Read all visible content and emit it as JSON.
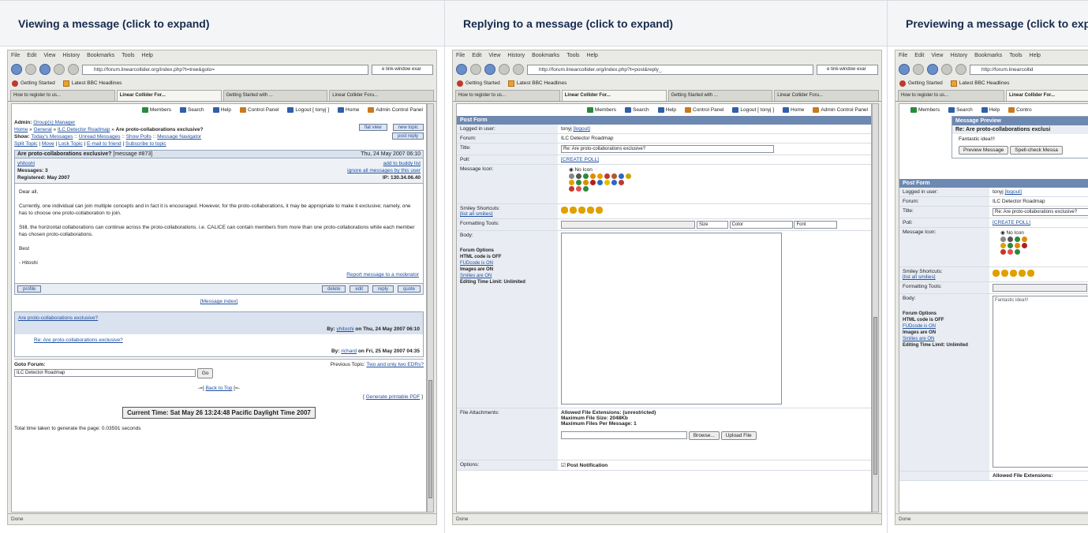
{
  "headers": {
    "view": "Viewing a message (click to expand)",
    "reply": "Replying to a message (click to expand)",
    "preview": "Previewing a message (click to expand)"
  },
  "browser": {
    "menu": [
      "File",
      "Edit",
      "View",
      "History",
      "Bookmarks",
      "Tools",
      "Help"
    ],
    "search_text": "e tink-window exar",
    "bookmarks": [
      "Getting Started",
      "Latest BBC Headlines"
    ],
    "status": "Done"
  },
  "view": {
    "url": "http://forum.linearcollider.org/index.php?t=tree&goto=",
    "tabs": [
      "How to register to us...",
      "Linear Collider For...",
      "Getting Started with ...",
      "Linear Collider Foru..."
    ],
    "toplinks": [
      "Members",
      "Search",
      "Help",
      "Control Panel",
      "Logout [ tonyj ]",
      "Home",
      "Admin Control Panel"
    ],
    "admin_label": "Admin:",
    "admin_link": "Group(s) Manager",
    "breadcrumb": [
      "Home",
      "General",
      "ILC Detector Roadmap"
    ],
    "breadcrumb_title": "Are proto-collaborations exclusive?",
    "show_label": "Show:",
    "show_links": [
      "Today's Messages",
      "Unread Messages",
      "Show Polls",
      "Message Navigator"
    ],
    "actions": [
      "Split Topic",
      "Move",
      "Lock Topic",
      "E-mail to friend",
      "Subscribe to topic"
    ],
    "right_btns": [
      "flat view",
      "new topic",
      "post reply"
    ],
    "msg_title": "Are proto-collaborations exclusive?",
    "msg_num": "[message #873]",
    "msg_date": "Thu, 24 May 2007 06:10",
    "author": "yhitoshi",
    "messages": "Messages: 3",
    "registered": "Registered: May 2007",
    "buddy": "add to buddy list",
    "ignore": "ignore all messages by this user",
    "ip": "IP: 130.34.06.40",
    "body": [
      "Dear all,",
      "Currently, one individual can join multiple concepts and in fact it is encouraged. However, for the proto-collaborations, it may be appropriate to make it exclusive; namely, one has to choose one proto-collaboration to join.",
      "Still, the horizontal collaborations can continue across the proto-collaborations. i.e. CALICE can contain members from more than one proto-collaborations while each member has chosen proto-collaborations.",
      "Best",
      "- Hitoshi"
    ],
    "report": "Report message to a moderator",
    "profile_btn": "profile",
    "msg_btns": [
      "delete",
      "edit",
      "reply",
      "quote"
    ],
    "msg_index": "[Message index]",
    "thread": [
      {
        "title": "Are proto-collaborations exclusive?",
        "by": "By:",
        "user": "yhitoshi",
        "date": "on Thu, 24 May 2007 06:10"
      },
      {
        "title": "Re: Are proto-collaborations exclusive?",
        "by": "By:",
        "user": "richard",
        "date": "on Fri, 25 May 2007 04:35"
      }
    ],
    "goto_label": "Goto Forum:",
    "goto_value": "ILC Detector Roadmap",
    "go_btn": "Go",
    "prev_label": "Previous Topic:",
    "prev_link": "Two and only two EDRs?",
    "back_to_top": "Back to Top",
    "back_pre": "-=]",
    "back_post": "[=-",
    "pdf": "Generate printable PDF",
    "current_time": "Current Time: Sat May 26 13:24:48 Pacific Daylight Time 2007",
    "timing": "Total time taken to generate the page: 0.03591 seconds"
  },
  "reply": {
    "url": "http://forum.linearcollider.org/index.php?t=post&reply_",
    "tabs": [
      "How to register to us...",
      "Linear Collider For...",
      "Getting Started with ...",
      "Linear Collider Foru..."
    ],
    "toplinks": [
      "Members",
      "Search",
      "Help",
      "Control Panel",
      "Logout [ tonyj ]",
      "Home",
      "Admin Control Panel"
    ],
    "form_head": "Post Form",
    "rows": {
      "user_l": "Logged in user:",
      "user_v": "tonyj",
      "logout": "[logout]",
      "forum_l": "Forum:",
      "forum_v": "ILC Detector Roadmap",
      "title_l": "Title:",
      "title_v": "Re: Are proto-collaborations exclusive?",
      "poll_l": "Poll:",
      "poll_v": "[CREATE POLL]",
      "icon_l": "Message Icon:",
      "no_icon": "No Icon",
      "smiley_l": "Smiley Shortcuts:",
      "smiley_list": "[list all smilies]",
      "fmt_l": "Formatting Tools:",
      "size": "Size",
      "color": "Color",
      "font": "Font",
      "body_l": "Body:",
      "opts_title": "Forum Options",
      "opt_html": "HTML code is OFF",
      "opt_fud": "FUDcode is ON",
      "opt_img": "Images are ON",
      "opt_smilies": "Smilies are ON",
      "opt_time": "Editing Time Limit: Unlimited",
      "attach_l": "File Attachments:",
      "att_ext": "Allowed File Extensions: (unrestricted)",
      "att_size": "Maximum File Size: 2048Kb",
      "att_max": "Maximum Files Per Message: 1",
      "browse": "Browse...",
      "upload": "Upload File",
      "opts_l": "Options:",
      "notify": "Post Notification"
    }
  },
  "preview": {
    "url": "http://forum.linearcollid",
    "tabs": [
      "How to register to us...",
      "Linear Collider For..."
    ],
    "toplinks": [
      "Members",
      "Search",
      "Help",
      "Contro"
    ],
    "preview_head": "Message Preview",
    "preview_title": "Re: Are proto-collaborations exclusi",
    "preview_body": "Fantastic idea!!!",
    "btn_preview": "Preview Message",
    "btn_spell": "Spell-check Messa",
    "body_text": "Fantastic idea!!!",
    "att_ext": "Allowed File Extensions:"
  }
}
